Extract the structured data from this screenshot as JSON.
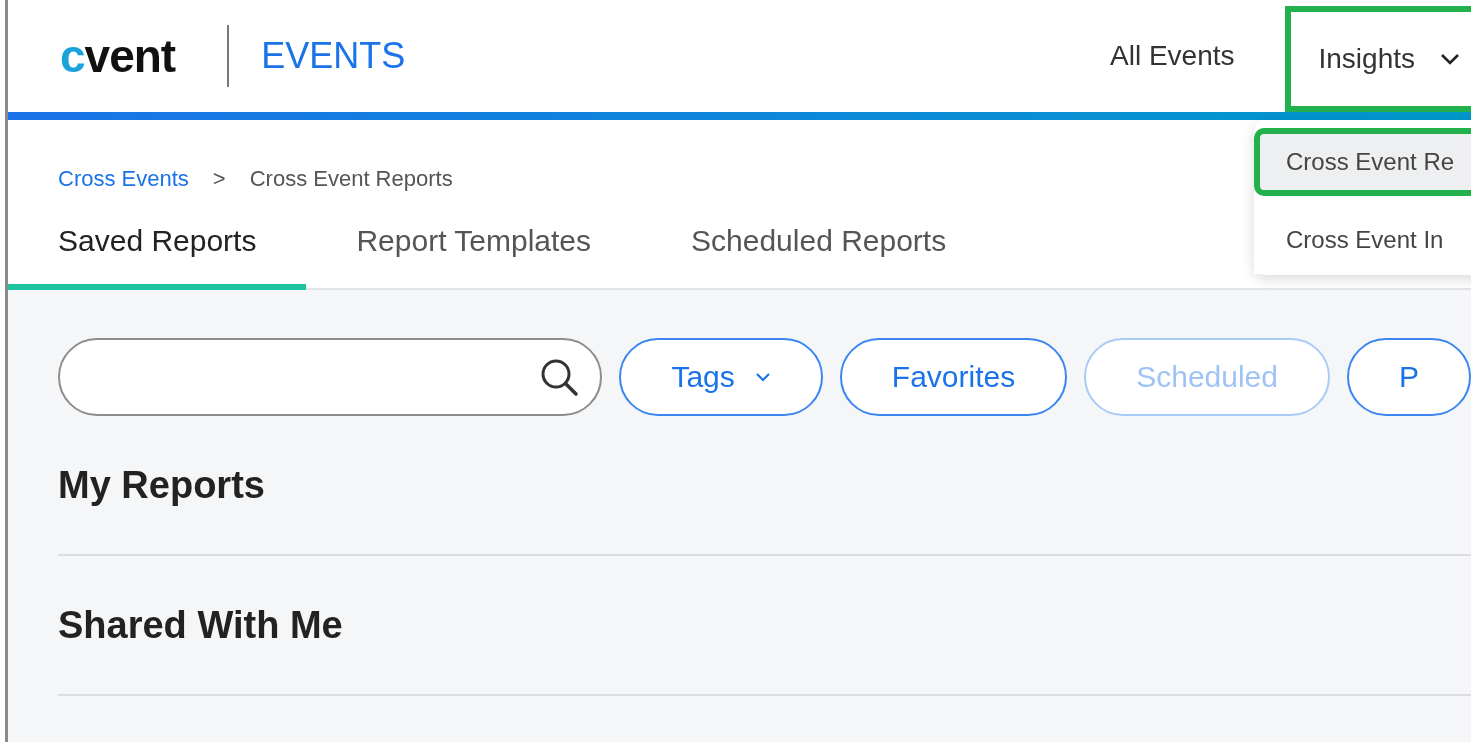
{
  "header": {
    "logo": "cvent",
    "product": "EVENTS",
    "nav": [
      {
        "label": "All Events",
        "dropdown": false,
        "highlighted": false
      },
      {
        "label": "Insights",
        "dropdown": true,
        "highlighted": true
      }
    ]
  },
  "dropdown_menu": {
    "items": [
      {
        "label": "Cross Event Re",
        "selected": true,
        "highlighted": true
      },
      {
        "label": "Cross Event In",
        "selected": false,
        "highlighted": false
      }
    ]
  },
  "breadcrumb": [
    {
      "label": "Cross Events",
      "link": true
    },
    {
      "label": ">",
      "link": false
    },
    {
      "label": "Cross Event Reports",
      "link": false
    }
  ],
  "tabs": [
    {
      "label": "Saved Reports",
      "selected": true
    },
    {
      "label": "Report Templates",
      "selected": false
    },
    {
      "label": "Scheduled Reports",
      "selected": false
    }
  ],
  "search": {
    "kind": "pill"
  },
  "filters": [
    {
      "label": "Tags",
      "dropdown": true,
      "disabled": false
    },
    {
      "label": "Favorites",
      "dropdown": false,
      "disabled": false
    },
    {
      "label": "Scheduled",
      "dropdown": false,
      "disabled": true
    },
    {
      "label": "P",
      "dropdown": false,
      "disabled": false
    }
  ],
  "sections": [
    {
      "title": "My Reports"
    },
    {
      "title": "Shared With Me"
    }
  ]
}
